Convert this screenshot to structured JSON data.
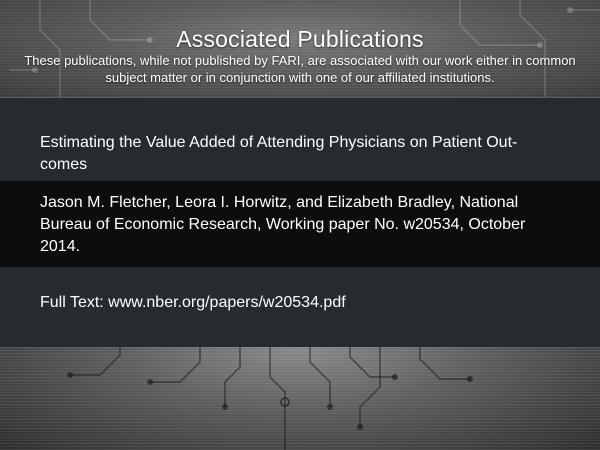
{
  "header": {
    "title": "Associated Publications",
    "subtitle": "These publications, while not published by FARI, are associated  with our work either in common subject matter or in conjunction with one of our affiliated institutions."
  },
  "publication": {
    "title": "Estimating the Value Added of Attending Physicians on Patient Out-comes",
    "citation": "Jason M. Fletcher, Leora I. Horwitz, and Elizabeth Bradley, National Bureau of Economic Research, Working paper No. w20534, October 2014.",
    "full_text": "Full Text: www.nber.org/papers/w20534.pdf"
  },
  "colors": {
    "panel": "#262b30",
    "citation_band": "#0d0d0d",
    "text": "#ffffff"
  }
}
